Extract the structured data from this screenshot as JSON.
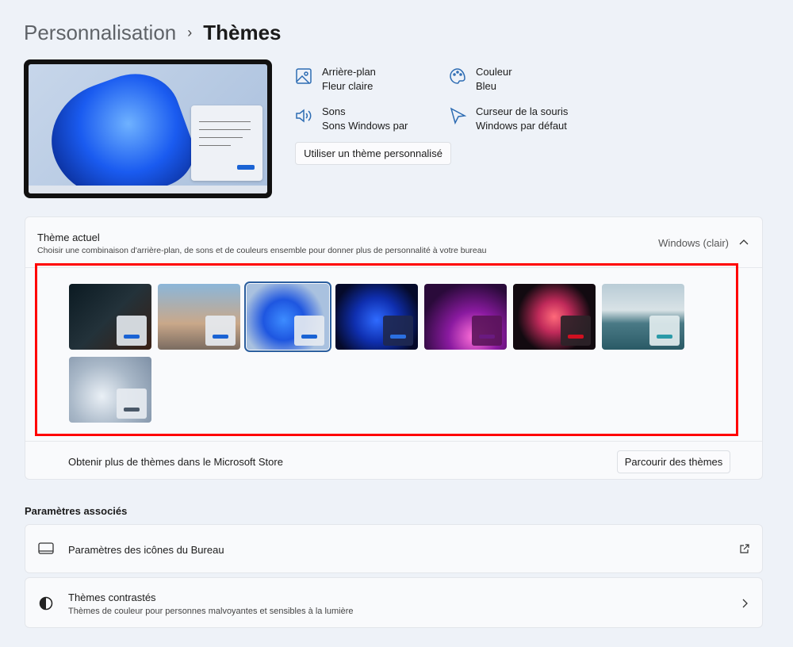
{
  "breadcrumb": {
    "parent": "Personnalisation",
    "separator": "›",
    "current": "Thèmes"
  },
  "properties": [
    {
      "icon": "image-icon",
      "label": "Arrière-plan",
      "value": "Fleur claire"
    },
    {
      "icon": "palette-icon",
      "label": "Couleur",
      "value": "Bleu"
    },
    {
      "icon": "speaker-icon",
      "label": "Sons",
      "value": "Sons Windows par"
    },
    {
      "icon": "cursor-icon",
      "label": "Curseur de la souris",
      "value": "Windows par défaut"
    }
  ],
  "custom_theme_button": "Utiliser un thème personnalisé",
  "current_theme": {
    "title": "Thème actuel",
    "description": "Choisir une combinaison d'arrière-plan, de sons et de couleurs ensemble pour donner plus de personnalité à votre bureau",
    "value": "Windows (clair)"
  },
  "themes": [
    {
      "name": "msi-dark",
      "bg": "linear-gradient(135deg,#0b1a22,#23323a 50%,#3a2014)",
      "card": "rgba(225,230,236,.92)",
      "accent": "#1a63d4",
      "selected": false
    },
    {
      "name": "beach-portrait",
      "bg": "linear-gradient(180deg,#8bb6d9,#c9a88a 60%,#7a6b60)",
      "card": "rgba(230,234,240,.92)",
      "accent": "#1a63d4",
      "selected": false
    },
    {
      "name": "windows-light",
      "bg": "radial-gradient(circle at 45% 55%,#3d8cff,#1e56e0 35%,#a9c1df 70%)",
      "card": "rgba(230,234,240,.92)",
      "accent": "#1a63d4",
      "selected": true
    },
    {
      "name": "windows-dark",
      "bg": "radial-gradient(circle at 50% 55%,#2f6bff,#0f2fb0 40%,#050a2a 80%)",
      "card": "rgba(30,40,80,.92)",
      "accent": "#2b6fe0",
      "selected": false
    },
    {
      "name": "glow",
      "bg": "radial-gradient(circle at 60% 80%,#ff6fd8,#8a1aa0 35%,#2a0a3a 75%)",
      "card": "rgba(90,20,90,.9)",
      "accent": "#6a1a80",
      "selected": false
    },
    {
      "name": "captured-motion",
      "bg": "radial-gradient(circle at 50% 50%,#ff6a7a,#c02a5a 30%,#120a10 70%)",
      "card": "rgba(45,35,40,.92)",
      "accent": "#d01020",
      "selected": false
    },
    {
      "name": "sunrise-lake",
      "bg": "linear-gradient(180deg,#b9ccd6,#d8e2e6 40%,#4a7a86 60%,#2a5a66)",
      "card": "rgba(225,235,238,.92)",
      "accent": "#2a9aa8",
      "selected": false
    },
    {
      "name": "flow",
      "bg": "radial-gradient(circle at 40% 60%,#eaf0f6,#a9b8c8 50%,#7e90a6)",
      "card": "rgba(230,234,240,.92)",
      "accent": "#4a5868",
      "selected": false
    }
  ],
  "store": {
    "text": "Obtenir plus de thèmes dans le Microsoft Store",
    "button": "Parcourir des thèmes"
  },
  "related": {
    "heading": "Paramètres associés",
    "items": [
      {
        "icon": "monitor-icon",
        "title": "Paramètres des icônes du Bureau",
        "subtitle": "",
        "action": "external-link-icon"
      },
      {
        "icon": "contrast-icon",
        "title": "Thèmes contrastés",
        "subtitle": "Thèmes de couleur pour personnes malvoyantes et sensibles à la lumière",
        "action": "chevron-right-icon"
      }
    ]
  },
  "highlight_color": "#ff0000"
}
